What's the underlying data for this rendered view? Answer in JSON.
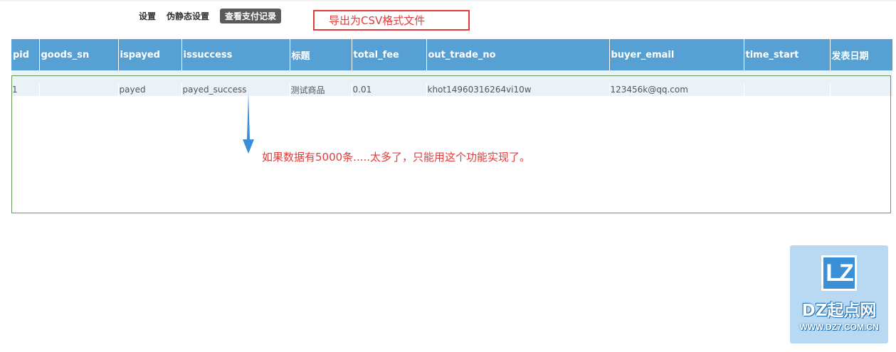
{
  "tabs": [
    {
      "label": "设置",
      "active": false
    },
    {
      "label": "伪静态设置",
      "active": false
    },
    {
      "label": "查看支付记录",
      "active": true
    }
  ],
  "annotations": {
    "export_note": "导出为CSV格式文件",
    "limit_note": "如果数据有5000条.....太多了，只能用这个功能实现了。"
  },
  "table": {
    "columns": [
      "pid",
      "goods_sn",
      "ispayed",
      "issuccess",
      "标题",
      "total_fee",
      "out_trade_no",
      "buyer_email",
      "time_start",
      "发表日期"
    ],
    "rows": [
      {
        "pid": "1",
        "goods_sn": "",
        "ispayed": "payed",
        "issuccess": "payed_success",
        "title": "测试商品",
        "total_fee": "0.01",
        "out_trade_no": "khot14960316264vi10w",
        "buyer_email": "123456k@qq.com",
        "time_start": "",
        "post_date": ""
      }
    ]
  },
  "watermark": {
    "logo_text": "LZ",
    "brand": "DZ起点网",
    "url": "WWW.DZ7.COM.CN"
  },
  "colors": {
    "header_bg": "#56a0d3",
    "annotation_red": "#e23b3b",
    "arrow_blue": "#3a8ed8",
    "frame_green": "#6a9a5a"
  }
}
